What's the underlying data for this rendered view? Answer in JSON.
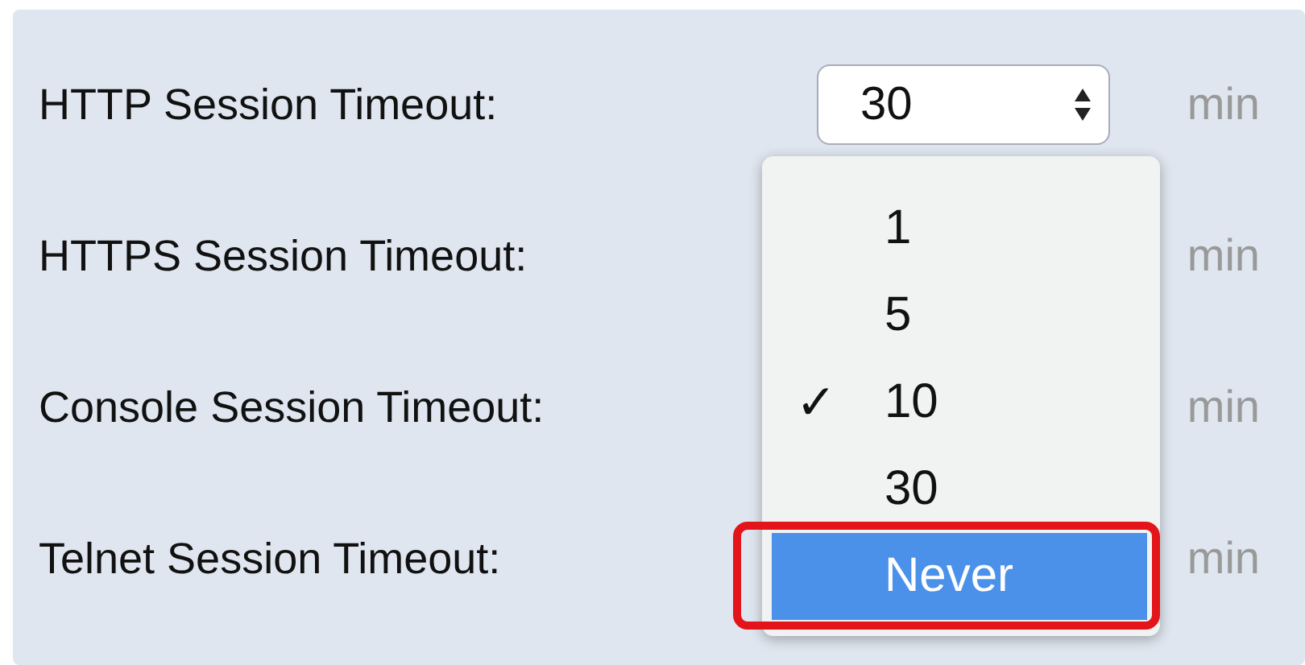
{
  "rows": [
    {
      "label": "HTTP Session Timeout:",
      "value": "30",
      "unit": "min"
    },
    {
      "label": "HTTPS Session Timeout:",
      "unit": "min"
    },
    {
      "label": "Console Session Timeout:",
      "unit": "min"
    },
    {
      "label": "Telnet Session Timeout:",
      "unit": "min"
    }
  ],
  "menu": {
    "items": [
      {
        "label": "1",
        "checked": false,
        "selected": false,
        "outlined": false
      },
      {
        "label": "5",
        "checked": false,
        "selected": false,
        "outlined": false
      },
      {
        "label": "10",
        "checked": true,
        "selected": false,
        "outlined": false
      },
      {
        "label": "30",
        "checked": false,
        "selected": false,
        "outlined": false
      },
      {
        "label": "Never",
        "checked": false,
        "selected": true,
        "outlined": true
      }
    ],
    "check_mark": "✓"
  }
}
